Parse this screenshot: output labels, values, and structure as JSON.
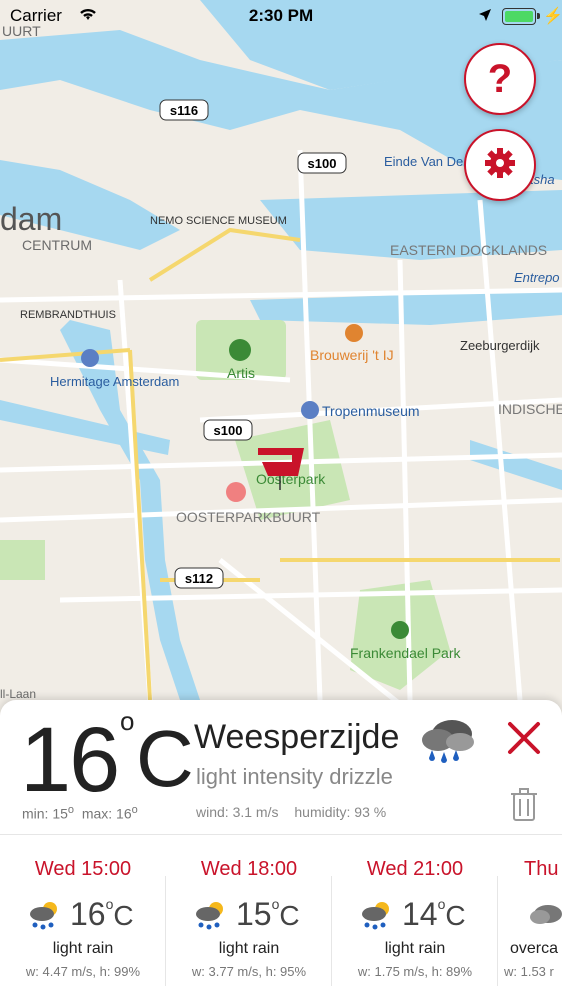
{
  "status_bar": {
    "carrier": "Carrier",
    "time": "2:30 PM"
  },
  "map": {
    "labels": {
      "nemo": "NEMO SCIENCE MUSEUM",
      "centrum": "CENTRUM",
      "dam": "dam",
      "rembrandthuis": "REMBRANDTHUIS",
      "hermitage": "Hermitage Amsterdam",
      "artis": "Artis",
      "brouwerij": "Brouwerij 't IJ",
      "tropenmuseum": "Tropenmuseum",
      "oosterpark": "Oosterpark",
      "oosterparkbuurt": "OOSTERPARKBUURT",
      "eastern_docklands": "EASTERN DOCKLANDS",
      "zeeburgerdijk": "Zeeburgerdijk",
      "indische_buurt": "INDISCHE BUURT",
      "frankendael": "Frankendael Park",
      "einde": "Einde Van De Wereld",
      "entrepot": "Entrepo",
      "uurt": "UURT",
      "laan": "ll-Laan",
      "tsha": "tsha"
    },
    "road_shields": [
      "s116",
      "s100",
      "s100",
      "s112"
    ]
  },
  "buttons": {
    "help_label": "?"
  },
  "weather": {
    "temp": "16",
    "unit": "C",
    "degree": "o",
    "min_label": "min: 15",
    "max_label": "max: 16",
    "city": "Weesperzijde",
    "description": "light intensity drizzle",
    "wind": "wind: 3.1 m/s",
    "humidity": "humidity: 93 %",
    "icon": "cloud-rain-icon"
  },
  "forecast": [
    {
      "when": "Wed 15:00",
      "temp": "16",
      "cond": "light rain",
      "wh": "w: 4.47 m/s, h: 99%",
      "icon": "sun-cloud-rain-icon"
    },
    {
      "when": "Wed 18:00",
      "temp": "15",
      "cond": "light rain",
      "wh": "w: 3.77 m/s, h: 95%",
      "icon": "sun-cloud-rain-icon"
    },
    {
      "when": "Wed 21:00",
      "temp": "14",
      "cond": "light rain",
      "wh": "w: 1.75 m/s, h: 89%",
      "icon": "sun-cloud-rain-icon"
    },
    {
      "when": "Thu",
      "temp": "",
      "cond": "overca",
      "wh": "w: 1.53 r",
      "icon": "cloud-icon"
    }
  ],
  "colors": {
    "accent": "#c9132a",
    "water": "#a6d8f0",
    "park": "#c9e6b5"
  }
}
